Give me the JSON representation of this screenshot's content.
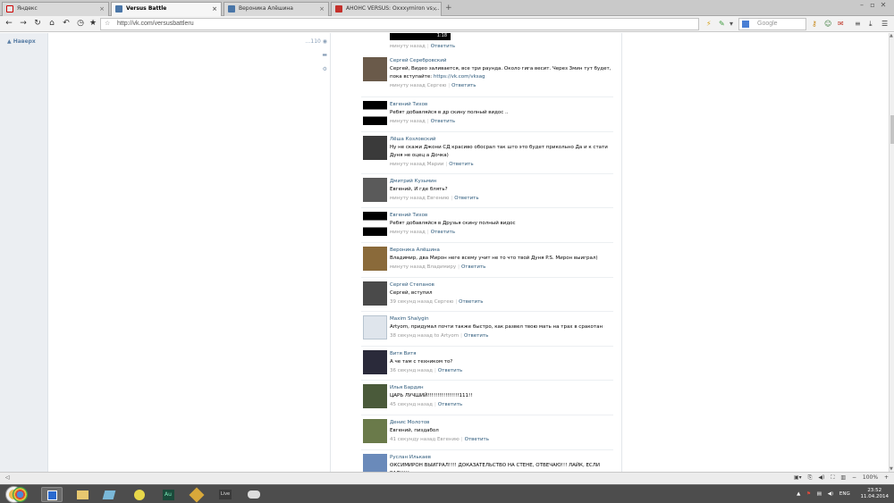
{
  "tabs": [
    {
      "label": "Яндекс",
      "icon": "yandex-icon",
      "color": "#e8e8e8",
      "active": false
    },
    {
      "label": "Versus Battle",
      "icon": "vk-icon",
      "color": "#4a76a8",
      "active": true
    },
    {
      "label": "Вероника Алёшина",
      "icon": "vk-icon",
      "color": "#4a76a8",
      "active": false
    },
    {
      "label": "АНОНС VERSUS: Oxxxymiron vs ...",
      "icon": "youtube-icon",
      "color": "#c4302b",
      "active": false
    }
  ],
  "address": {
    "url": "http://vk.com/versusbattleru"
  },
  "search": {
    "placeholder": "Google"
  },
  "page": {
    "back_to_top": "Наверх",
    "side_count": "110",
    "video_duration": "1:18",
    "top_meta_time": "минуту назад",
    "reply_label": "Ответить"
  },
  "posts": [
    {
      "author": "Сергей Серебровский",
      "text": "Сергей, Видео заливается, все три раунда. Около гига весит. Через 3мин тут будет, пока вступайте:",
      "link": "https://vk.com/vksag",
      "time": "минуту назад Сергею"
    },
    {
      "author": "Евгений Тихов",
      "text": "Ребят добавляйся в др скину полный видос ..",
      "time": "минуту назад"
    },
    {
      "author": "Лёша Козловский",
      "text": "Ну не скажи Джони СД красиво обосрал так што это будет прикольно Да и к стати Дуня не оцец а Дочка)",
      "time": "минуту назад Марии"
    },
    {
      "author": "Дмитрий Кузьмин",
      "text": "Евгений, И где блять?",
      "time": "минуту назад Евгению"
    },
    {
      "author": "Евгений Тихов",
      "text": "Ребят добавляйся в Друзья скину полный видос",
      "time": "минуту назад"
    },
    {
      "author": "Вероника Алёшина",
      "text": "Владимир, два Мирон неге всему учит не то что твой Дуня P.S. Мирон выиграл)",
      "time": "минуту назад Владимиру"
    },
    {
      "author": "Сергей Степанов",
      "text": "Сергей, вступил",
      "time": "39 секунд назад Сергею"
    },
    {
      "author": "Maxim Shalygin",
      "text": "Artyom, придумал почти также быстро, как развел твою мать на трах в сракотан",
      "time": "38 секунд назад to Artyom"
    },
    {
      "author": "Витя Витя",
      "text": "А че там с техником то?",
      "time": "36 секунд назад"
    },
    {
      "author": "Илья Бардин",
      "text": "ЦАРЬ ЛУЧШИЙ!!!!!!!!!!!!!!!!111!!",
      "time": "45 секунд назад"
    },
    {
      "author": "Денис Молотов",
      "text": "Евгений, пиздабол",
      "time": "41 секунду назад Евгению"
    },
    {
      "author": "Руслан Илькаев",
      "text": "ОКСИМИРОН ВЫИГРАЛ!!!! ДОКАЗАТЕЛЬСТВО НА СТЕНЕ, ОТВЕЧАЮ!!! ЛАЙК, ЕСЛИ РАД)))))",
      "time": ""
    }
  ],
  "statusbar": {
    "zoom": "100%"
  },
  "taskbar": {
    "apps": [
      "Chrome",
      "Opera",
      "Explorer",
      "Notes",
      "Winamp",
      "Au",
      "Tool",
      "Live",
      "Game"
    ],
    "lang": "ENG",
    "time": "23:52",
    "date": "11.04.2014"
  }
}
